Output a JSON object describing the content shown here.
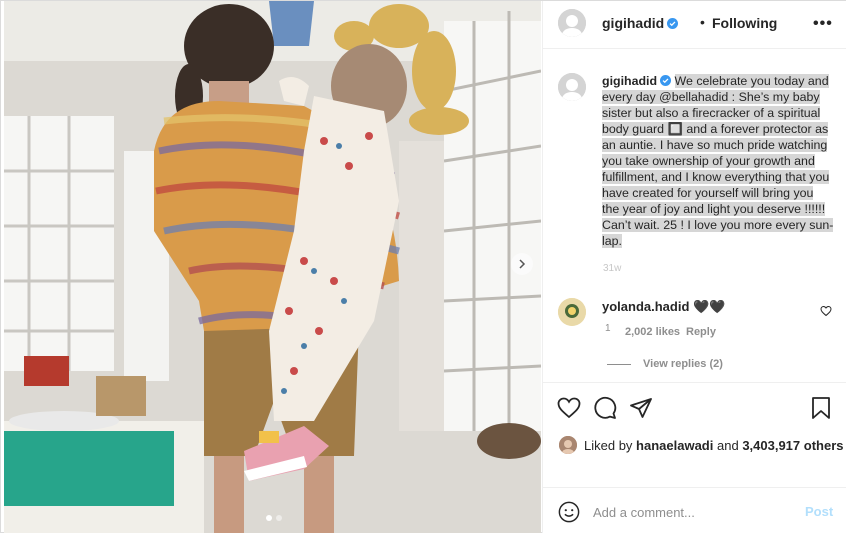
{
  "header": {
    "username": "gigihadid",
    "separator": "•",
    "follow_state": "Following",
    "more_label": "•••"
  },
  "photo": {
    "carousel": {
      "slides": 2,
      "active_slide": 1
    }
  },
  "caption": {
    "username": "gigihadid",
    "text": "We celebrate you today and every day @bellahadid : She’s my baby sister but also a firecracker of a spiritual body guard 🔲 and a forever protector as an auntie. I have so much pride watching you take ownership of your growth and fulfillment, and I know everything that you have created for yourself will bring you the year of joy and light you deserve !!!!!! Can’t wait. 25 ! I love you more every sun-lap.",
    "time": "31w"
  },
  "comments": [
    {
      "username": "yolanda.hadid",
      "text": "🖤🖤",
      "time": "1",
      "likes": "2,002 likes",
      "reply_label": "Reply"
    }
  ],
  "view_replies": "View replies (2)",
  "likes_summary": {
    "prefix": "Liked by",
    "user": "hanaelawadi",
    "and_word": "and",
    "count": "3,403,917 others"
  },
  "add_comment": {
    "placeholder": "Add a comment...",
    "post_label": "Post"
  },
  "colors": {
    "verified": "#3897f0",
    "post_button": "#b2dffc",
    "muted_text": "#8e8e8e",
    "caption_highlight": "#d6d6d6"
  },
  "icons": [
    "verified-badge-icon",
    "more-options-icon",
    "heart-icon",
    "comment-icon",
    "share-icon",
    "bookmark-icon",
    "emoji-icon",
    "chevron-right-icon"
  ]
}
